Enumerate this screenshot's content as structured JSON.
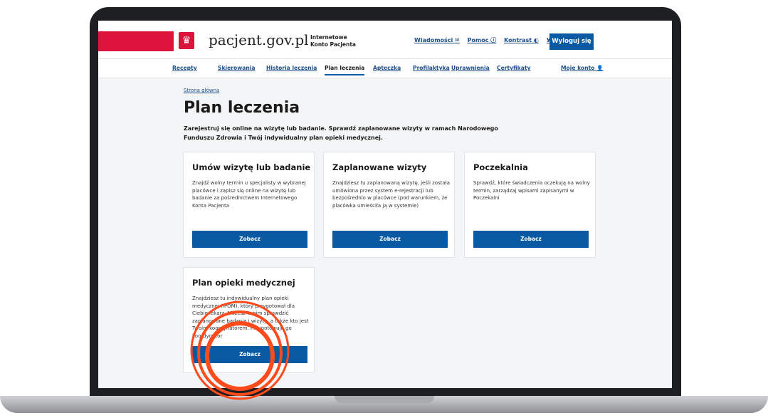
{
  "header": {
    "logo_text": "pacjent.gov.pl",
    "logo_sub_line1": "Internetowe",
    "logo_sub_line2": "Konto Pacjenta",
    "links": [
      "Wiadomości ✉",
      "Pomoc ⓘ",
      "Kontrast ◐",
      "УК"
    ],
    "logout_label": "Wyloguj się"
  },
  "nav": {
    "items": [
      "Recepty",
      "Skierowania",
      "Historia leczenia",
      "Plan leczenia",
      "Apteczka",
      "Profilaktyka",
      "Uprawnienia",
      "Certyfikaty",
      "Moje konto 👤"
    ],
    "active": "Plan leczenia"
  },
  "breadcrumb": "Strona główna",
  "page_title": "Plan leczenia",
  "lead_text": "Zarejestruj się online na wizytę lub badanie. Sprawdź zaplanowane wizyty w ramach Narodowego Funduszu Zdrowia i Twój indywidualny plan opieki medycznej.",
  "cards": [
    {
      "title": "Umów wizytę lub badanie",
      "text": "Znajdź wolny termin u specjalisty w wybranej placówce i zapisz się online na wizytę lub badanie za pośrednictwem Internetowego Konta Pacjenta",
      "button": "Zobacz"
    },
    {
      "title": "Zaplanowane wizyty",
      "text": "Znajdziesz tu zaplanowaną wizytę, jeśli została umówiona przez system e-rejestracji lub bezpośrednio w placówce (pod warunkiem, że placówka umieściła ją w systemie)",
      "button": "Zobacz"
    },
    {
      "title": "Poczekalnia",
      "text": "Sprawdź, które świadczenia oczekują na wolny termin, zarządzaj wpisami zapisanymi w Poczekalni",
      "button": "Zobacz"
    },
    {
      "title": "Plan opieki medycznej",
      "text": "Znajdziesz tu indywidualny plan opieki medycznej (IPOM), który przygotował dla Ciebie lekarz. Możesz w nim sprawdzić zaplanowane badania i wizyty, a także kto jest Twoim koordynatorem. Przygotowuje go koordynator",
      "button": "Zobacz"
    }
  ],
  "colors": {
    "accent": "#0a5aa3",
    "brand_red": "#dc143c",
    "ring": "#ff4a1c"
  }
}
